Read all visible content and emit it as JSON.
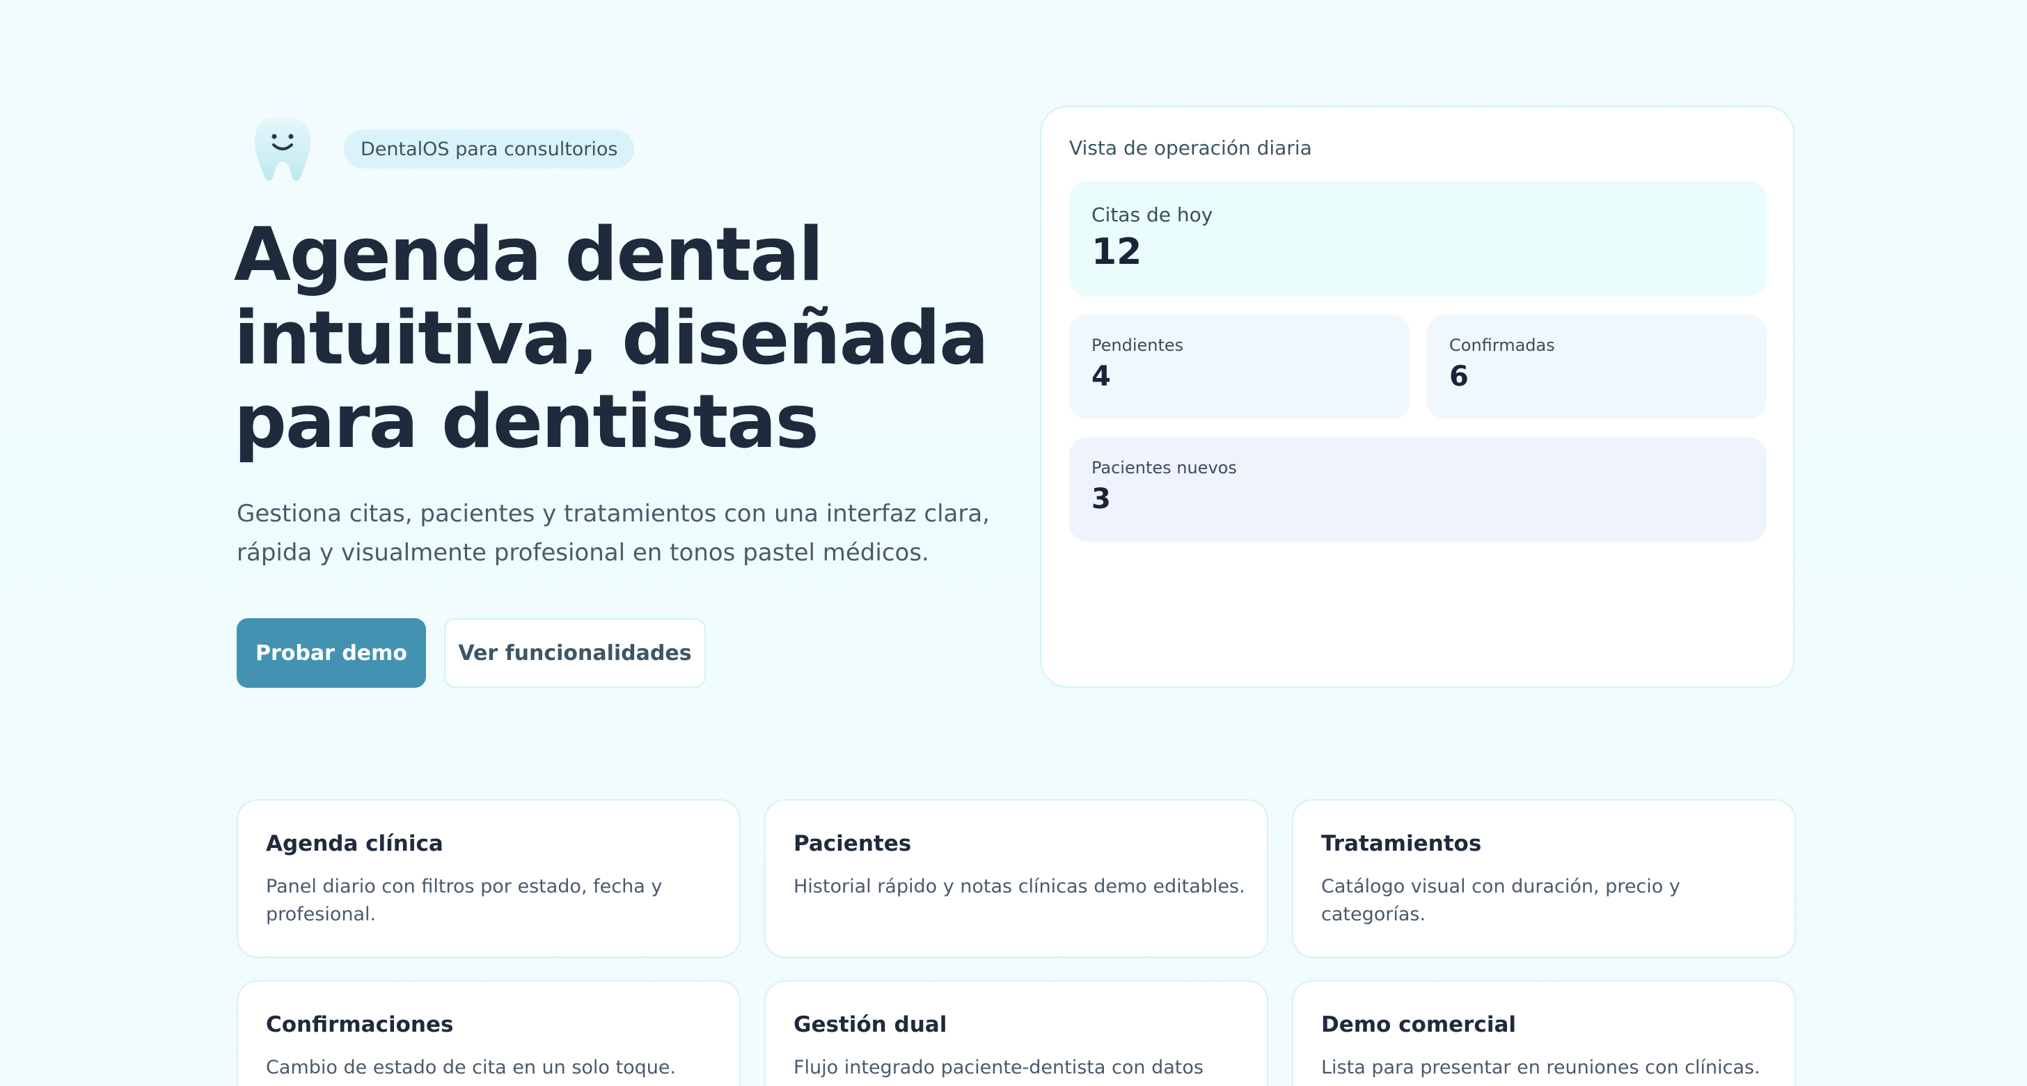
{
  "brand": {
    "tag": "DentalOS para consultorios",
    "logo_icon": "tooth-icon",
    "logo_color": "#cdeef4"
  },
  "hero": {
    "title_lines": [
      "Agenda dental",
      "intuitiva, diseñada",
      "para dentistas"
    ],
    "subtitle_lines": [
      "Gestiona citas, pacientes y tratamientos con una interfaz clara,",
      "rápida y visualmente profesional en tonos pastel médicos."
    ],
    "primary_button": "Probar demo",
    "secondary_button": "Ver funcionalidades"
  },
  "ops": {
    "title": "Vista de operación diaria",
    "today": {
      "label": "Citas de hoy",
      "value": "12"
    },
    "pending": {
      "label": "Pendientes",
      "value": "4"
    },
    "confirmed": {
      "label": "Confirmadas",
      "value": "6"
    },
    "new_patients": {
      "label": "Pacientes nuevos",
      "value": "3"
    }
  },
  "features": [
    {
      "title": "Agenda clínica",
      "desc": "Panel diario con filtros por estado, fecha y profesional."
    },
    {
      "title": "Pacientes",
      "desc": "Historial rápido y notas clínicas demo editables."
    },
    {
      "title": "Tratamientos",
      "desc": "Catálogo visual con duración, precio y categorías."
    },
    {
      "title": "Confirmaciones",
      "desc": "Cambio de estado de cita en un solo toque."
    },
    {
      "title": "Gestión dual",
      "desc": "Flujo integrado paciente-dentista con datos"
    },
    {
      "title": "Demo comercial",
      "desc": "Lista para presentar en reuniones con clínicas."
    }
  ],
  "colors": {
    "primary": "#4392b2",
    "text_dark": "#1f2a3d",
    "pill_bg": "#d9f3f8",
    "card_border": "#d6f2f7"
  }
}
